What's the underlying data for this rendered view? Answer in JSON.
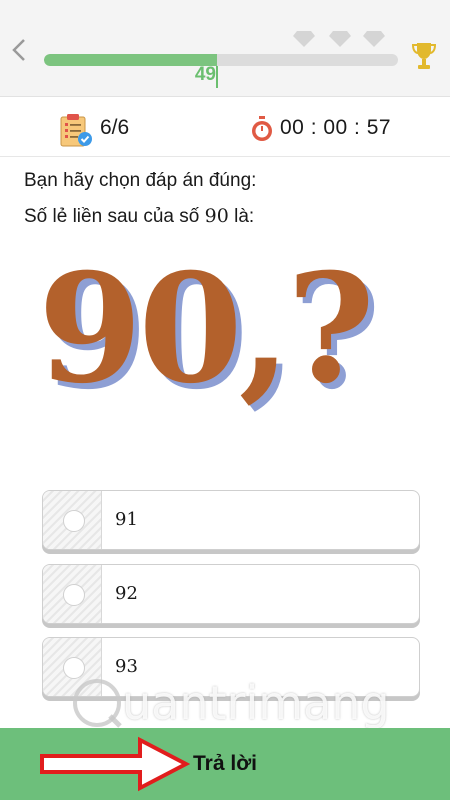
{
  "header": {
    "progress_value": "49",
    "progress_fraction": 0.49,
    "gems_count": 3,
    "trophy_color": "#e2b92d",
    "accent_color": "#7cc47f"
  },
  "stats": {
    "count": "6/6",
    "timer": "00 : 00 : 57"
  },
  "question": {
    "prompt": "Bạn hãy chọn đáp án đúng:",
    "text_prefix": "Số lẻ liền sau của số ",
    "number": "90",
    "text_suffix": " là:",
    "image_text": "90,?"
  },
  "options": [
    {
      "label": "91"
    },
    {
      "label": "92"
    },
    {
      "label": "93"
    }
  ],
  "submit": {
    "label": "Trả lời",
    "bar_color": "#6dbf7b"
  },
  "watermark": {
    "text": "uantrimang"
  },
  "icons": {
    "back": "chevron-left-icon",
    "gem": "diamond-icon",
    "trophy": "trophy-icon",
    "clipboard": "clipboard-check-icon",
    "stopwatch": "stopwatch-icon",
    "arrow": "arrow-right-icon"
  }
}
